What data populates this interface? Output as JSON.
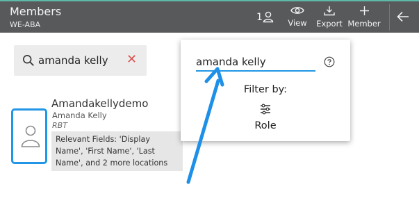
{
  "header": {
    "title": "Members",
    "subtitle": "WE-ABA",
    "selected_count": "1",
    "buttons": {
      "view": "View",
      "export": "Export",
      "member": "Member"
    },
    "icons": [
      "user-icon",
      "eye-icon",
      "download-icon",
      "plus-icon",
      "arrow-left-icon"
    ]
  },
  "search": {
    "value": "amanda kelly",
    "icons": [
      "search-icon",
      "close-icon"
    ]
  },
  "result": {
    "display_name": "Amandakellydemo",
    "full_name": "Amanda Kelly",
    "role": "RBT",
    "relevant_fields": "Relevant Fields: 'Display Name', 'First Name', 'Last Name', and 2 more locations",
    "icons": [
      "user-avatar-icon"
    ]
  },
  "popup": {
    "search_value": "amanda kelly",
    "filter_by": "Filter by:",
    "role_filter": "Role",
    "icons": [
      "help-icon",
      "sliders-icon"
    ]
  },
  "colors": {
    "header_bg": "#58595b",
    "accent_blue": "#2196e6",
    "clear_red": "#d9534f",
    "annotation_arrow": "#1e90e8"
  }
}
